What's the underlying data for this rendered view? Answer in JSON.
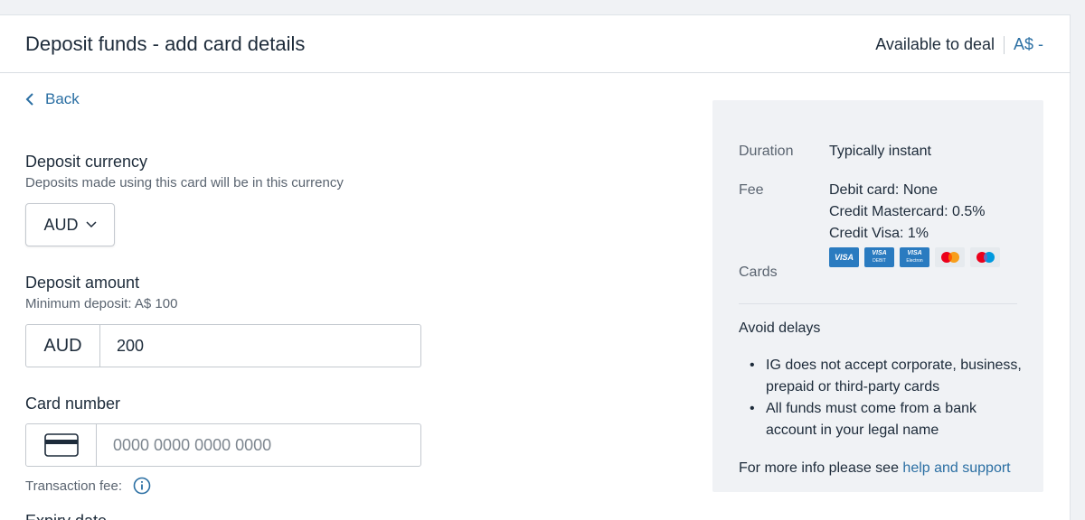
{
  "header": {
    "title": "Deposit funds - add card details",
    "available_label": "Available to deal",
    "available_value": "A$ -"
  },
  "back_label": "Back",
  "deposit_currency": {
    "label": "Deposit currency",
    "hint": "Deposits made using this card will be in this currency",
    "selected": "AUD"
  },
  "deposit_amount": {
    "label": "Deposit amount",
    "hint": "Minimum deposit: A$ 100",
    "currency": "AUD",
    "value": "200"
  },
  "card_number": {
    "label": "Card number",
    "placeholder": "0000 0000 0000 0000",
    "icon": "credit-card-icon"
  },
  "transaction_fee_label": "Transaction fee:",
  "expiry_label": "Expiry date",
  "info": {
    "duration_key": "Duration",
    "duration_value": "Typically instant",
    "fee_key": "Fee",
    "fee_values": [
      "Debit card: None",
      "Credit Mastercard: 0.5%",
      "Credit Visa: 1%"
    ],
    "cards_key": "Cards",
    "card_logos": [
      {
        "name": "visa-logo",
        "text": "VISA"
      },
      {
        "name": "visa-debit-logo",
        "text": "VISA",
        "sub": "DEBIT"
      },
      {
        "name": "visa-electron-logo",
        "text": "VISA",
        "sub": "Electron"
      },
      {
        "name": "mastercard-logo"
      },
      {
        "name": "maestro-logo"
      }
    ],
    "avoid_title": "Avoid delays",
    "avoid_items": [
      "IG does not accept corporate, business, prepaid or third-party cards",
      "All funds must come from a bank account in your legal name"
    ],
    "more_info_prefix": "For more info please see ",
    "more_info_link": "help and support"
  },
  "colors": {
    "link": "#2b6fa3",
    "text": "#1d2b3a",
    "muted": "#5a6470",
    "panel_bg": "#f0f2f5",
    "visa_blue": "#2a7bc0"
  }
}
